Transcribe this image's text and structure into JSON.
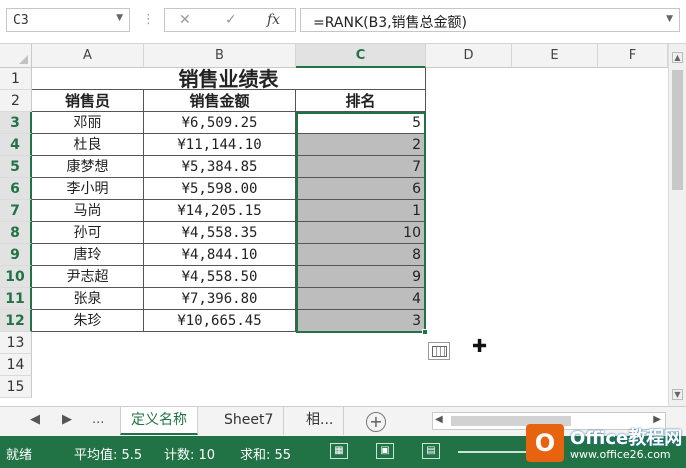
{
  "formula_bar": {
    "name_box": "C3",
    "separator": "⋮",
    "cancel_glyph": "✕",
    "enter_glyph": "✓",
    "fx_glyph": "fx",
    "formula": "=RANK(B3,销售总金额)"
  },
  "columns": [
    "A",
    "B",
    "C",
    "D",
    "E",
    "F"
  ],
  "rows": [
    "1",
    "2",
    "3",
    "4",
    "5",
    "6",
    "7",
    "8",
    "9",
    "10",
    "11",
    "12",
    "13",
    "14",
    "15"
  ],
  "sheet": {
    "title": "销售业绩表",
    "headers": [
      "销售员",
      "销售金额",
      "排名"
    ],
    "data": [
      {
        "name": "邓丽",
        "amount": "¥6,509.25",
        "rank": "5"
      },
      {
        "name": "杜良",
        "amount": "¥11,144.10",
        "rank": "2"
      },
      {
        "name": "康梦想",
        "amount": "¥5,384.85",
        "rank": "7"
      },
      {
        "name": "李小明",
        "amount": "¥5,598.00",
        "rank": "6"
      },
      {
        "name": "马尚",
        "amount": "¥14,205.15",
        "rank": "1"
      },
      {
        "name": "孙可",
        "amount": "¥4,558.35",
        "rank": "10"
      },
      {
        "name": "唐玲",
        "amount": "¥4,844.10",
        "rank": "8"
      },
      {
        "name": "尹志超",
        "amount": "¥4,558.50",
        "rank": "9"
      },
      {
        "name": "张泉",
        "amount": "¥7,396.80",
        "rank": "4"
      },
      {
        "name": "朱珍",
        "amount": "¥10,665.45",
        "rank": "3"
      }
    ]
  },
  "tabs": {
    "nav_prev": "◀",
    "nav_next": "▶",
    "nav_more": "...",
    "items": [
      "定义名称",
      "Sheet7",
      "相..."
    ],
    "add": "+"
  },
  "status": {
    "ready": "就绪",
    "average": "平均值: 5.5",
    "count": "计数: 10",
    "sum": "求和: 55"
  },
  "watermark": {
    "brand": "Office教程网",
    "url": "www.office26.com"
  },
  "colors": {
    "accent": "#217346",
    "selected_fill": "#bdbdbd"
  }
}
